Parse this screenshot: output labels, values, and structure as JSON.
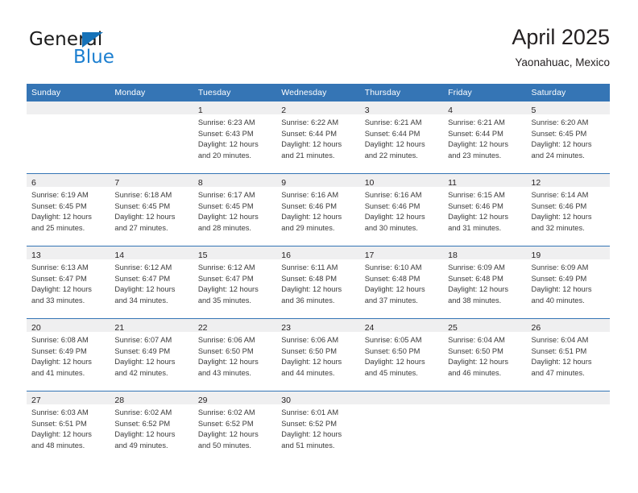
{
  "brand": {
    "name_top": "General",
    "name_bottom": "Blue",
    "triangle_color": "#1672b8",
    "blue_color": "#1c7fd0"
  },
  "header": {
    "title": "April 2025",
    "subtitle": "Yaonahuac, Mexico",
    "accent_color": "#3575b5",
    "band_color": "#efeff0"
  },
  "calendar": {
    "weekday_headers": [
      "Sunday",
      "Monday",
      "Tuesday",
      "Wednesday",
      "Thursday",
      "Friday",
      "Saturday"
    ],
    "weeks": [
      [
        {
          "day": "",
          "lines": []
        },
        {
          "day": "",
          "lines": []
        },
        {
          "day": "1",
          "lines": [
            "Sunrise: 6:23 AM",
            "Sunset: 6:43 PM",
            "Daylight: 12 hours",
            "and 20 minutes."
          ]
        },
        {
          "day": "2",
          "lines": [
            "Sunrise: 6:22 AM",
            "Sunset: 6:44 PM",
            "Daylight: 12 hours",
            "and 21 minutes."
          ]
        },
        {
          "day": "3",
          "lines": [
            "Sunrise: 6:21 AM",
            "Sunset: 6:44 PM",
            "Daylight: 12 hours",
            "and 22 minutes."
          ]
        },
        {
          "day": "4",
          "lines": [
            "Sunrise: 6:21 AM",
            "Sunset: 6:44 PM",
            "Daylight: 12 hours",
            "and 23 minutes."
          ]
        },
        {
          "day": "5",
          "lines": [
            "Sunrise: 6:20 AM",
            "Sunset: 6:45 PM",
            "Daylight: 12 hours",
            "and 24 minutes."
          ]
        }
      ],
      [
        {
          "day": "6",
          "lines": [
            "Sunrise: 6:19 AM",
            "Sunset: 6:45 PM",
            "Daylight: 12 hours",
            "and 25 minutes."
          ]
        },
        {
          "day": "7",
          "lines": [
            "Sunrise: 6:18 AM",
            "Sunset: 6:45 PM",
            "Daylight: 12 hours",
            "and 27 minutes."
          ]
        },
        {
          "day": "8",
          "lines": [
            "Sunrise: 6:17 AM",
            "Sunset: 6:45 PM",
            "Daylight: 12 hours",
            "and 28 minutes."
          ]
        },
        {
          "day": "9",
          "lines": [
            "Sunrise: 6:16 AM",
            "Sunset: 6:46 PM",
            "Daylight: 12 hours",
            "and 29 minutes."
          ]
        },
        {
          "day": "10",
          "lines": [
            "Sunrise: 6:16 AM",
            "Sunset: 6:46 PM",
            "Daylight: 12 hours",
            "and 30 minutes."
          ]
        },
        {
          "day": "11",
          "lines": [
            "Sunrise: 6:15 AM",
            "Sunset: 6:46 PM",
            "Daylight: 12 hours",
            "and 31 minutes."
          ]
        },
        {
          "day": "12",
          "lines": [
            "Sunrise: 6:14 AM",
            "Sunset: 6:46 PM",
            "Daylight: 12 hours",
            "and 32 minutes."
          ]
        }
      ],
      [
        {
          "day": "13",
          "lines": [
            "Sunrise: 6:13 AM",
            "Sunset: 6:47 PM",
            "Daylight: 12 hours",
            "and 33 minutes."
          ]
        },
        {
          "day": "14",
          "lines": [
            "Sunrise: 6:12 AM",
            "Sunset: 6:47 PM",
            "Daylight: 12 hours",
            "and 34 minutes."
          ]
        },
        {
          "day": "15",
          "lines": [
            "Sunrise: 6:12 AM",
            "Sunset: 6:47 PM",
            "Daylight: 12 hours",
            "and 35 minutes."
          ]
        },
        {
          "day": "16",
          "lines": [
            "Sunrise: 6:11 AM",
            "Sunset: 6:48 PM",
            "Daylight: 12 hours",
            "and 36 minutes."
          ]
        },
        {
          "day": "17",
          "lines": [
            "Sunrise: 6:10 AM",
            "Sunset: 6:48 PM",
            "Daylight: 12 hours",
            "and 37 minutes."
          ]
        },
        {
          "day": "18",
          "lines": [
            "Sunrise: 6:09 AM",
            "Sunset: 6:48 PM",
            "Daylight: 12 hours",
            "and 38 minutes."
          ]
        },
        {
          "day": "19",
          "lines": [
            "Sunrise: 6:09 AM",
            "Sunset: 6:49 PM",
            "Daylight: 12 hours",
            "and 40 minutes."
          ]
        }
      ],
      [
        {
          "day": "20",
          "lines": [
            "Sunrise: 6:08 AM",
            "Sunset: 6:49 PM",
            "Daylight: 12 hours",
            "and 41 minutes."
          ]
        },
        {
          "day": "21",
          "lines": [
            "Sunrise: 6:07 AM",
            "Sunset: 6:49 PM",
            "Daylight: 12 hours",
            "and 42 minutes."
          ]
        },
        {
          "day": "22",
          "lines": [
            "Sunrise: 6:06 AM",
            "Sunset: 6:50 PM",
            "Daylight: 12 hours",
            "and 43 minutes."
          ]
        },
        {
          "day": "23",
          "lines": [
            "Sunrise: 6:06 AM",
            "Sunset: 6:50 PM",
            "Daylight: 12 hours",
            "and 44 minutes."
          ]
        },
        {
          "day": "24",
          "lines": [
            "Sunrise: 6:05 AM",
            "Sunset: 6:50 PM",
            "Daylight: 12 hours",
            "and 45 minutes."
          ]
        },
        {
          "day": "25",
          "lines": [
            "Sunrise: 6:04 AM",
            "Sunset: 6:50 PM",
            "Daylight: 12 hours",
            "and 46 minutes."
          ]
        },
        {
          "day": "26",
          "lines": [
            "Sunrise: 6:04 AM",
            "Sunset: 6:51 PM",
            "Daylight: 12 hours",
            "and 47 minutes."
          ]
        }
      ],
      [
        {
          "day": "27",
          "lines": [
            "Sunrise: 6:03 AM",
            "Sunset: 6:51 PM",
            "Daylight: 12 hours",
            "and 48 minutes."
          ]
        },
        {
          "day": "28",
          "lines": [
            "Sunrise: 6:02 AM",
            "Sunset: 6:52 PM",
            "Daylight: 12 hours",
            "and 49 minutes."
          ]
        },
        {
          "day": "29",
          "lines": [
            "Sunrise: 6:02 AM",
            "Sunset: 6:52 PM",
            "Daylight: 12 hours",
            "and 50 minutes."
          ]
        },
        {
          "day": "30",
          "lines": [
            "Sunrise: 6:01 AM",
            "Sunset: 6:52 PM",
            "Daylight: 12 hours",
            "and 51 minutes."
          ]
        },
        {
          "day": "",
          "lines": []
        },
        {
          "day": "",
          "lines": []
        },
        {
          "day": "",
          "lines": []
        }
      ]
    ]
  }
}
